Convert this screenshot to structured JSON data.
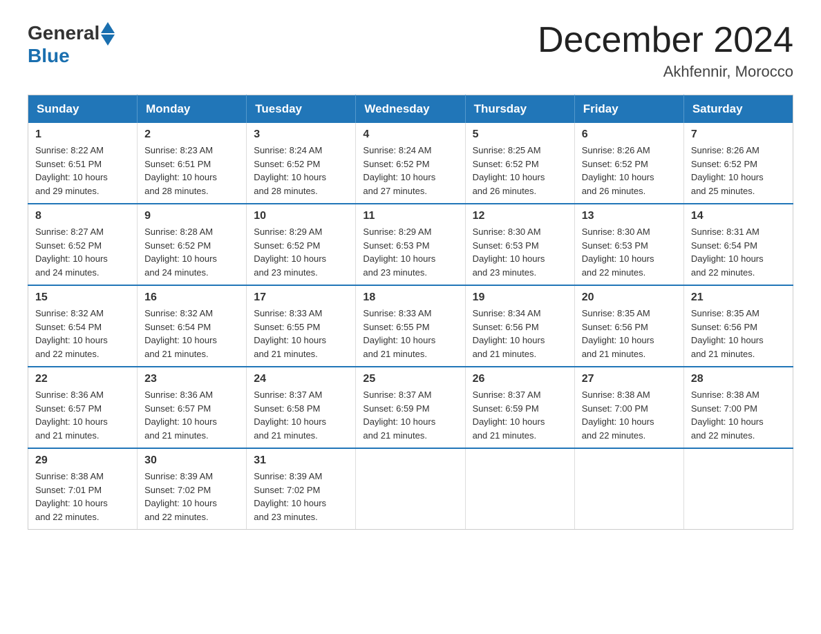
{
  "header": {
    "logo_general": "General",
    "logo_blue": "Blue",
    "month_title": "December 2024",
    "location": "Akhfennir, Morocco"
  },
  "weekdays": [
    "Sunday",
    "Monday",
    "Tuesday",
    "Wednesday",
    "Thursday",
    "Friday",
    "Saturday"
  ],
  "weeks": [
    [
      {
        "day": "1",
        "sunrise": "8:22 AM",
        "sunset": "6:51 PM",
        "daylight": "10 hours and 29 minutes."
      },
      {
        "day": "2",
        "sunrise": "8:23 AM",
        "sunset": "6:51 PM",
        "daylight": "10 hours and 28 minutes."
      },
      {
        "day": "3",
        "sunrise": "8:24 AM",
        "sunset": "6:52 PM",
        "daylight": "10 hours and 28 minutes."
      },
      {
        "day": "4",
        "sunrise": "8:24 AM",
        "sunset": "6:52 PM",
        "daylight": "10 hours and 27 minutes."
      },
      {
        "day": "5",
        "sunrise": "8:25 AM",
        "sunset": "6:52 PM",
        "daylight": "10 hours and 26 minutes."
      },
      {
        "day": "6",
        "sunrise": "8:26 AM",
        "sunset": "6:52 PM",
        "daylight": "10 hours and 26 minutes."
      },
      {
        "day": "7",
        "sunrise": "8:26 AM",
        "sunset": "6:52 PM",
        "daylight": "10 hours and 25 minutes."
      }
    ],
    [
      {
        "day": "8",
        "sunrise": "8:27 AM",
        "sunset": "6:52 PM",
        "daylight": "10 hours and 24 minutes."
      },
      {
        "day": "9",
        "sunrise": "8:28 AM",
        "sunset": "6:52 PM",
        "daylight": "10 hours and 24 minutes."
      },
      {
        "day": "10",
        "sunrise": "8:29 AM",
        "sunset": "6:52 PM",
        "daylight": "10 hours and 23 minutes."
      },
      {
        "day": "11",
        "sunrise": "8:29 AM",
        "sunset": "6:53 PM",
        "daylight": "10 hours and 23 minutes."
      },
      {
        "day": "12",
        "sunrise": "8:30 AM",
        "sunset": "6:53 PM",
        "daylight": "10 hours and 23 minutes."
      },
      {
        "day": "13",
        "sunrise": "8:30 AM",
        "sunset": "6:53 PM",
        "daylight": "10 hours and 22 minutes."
      },
      {
        "day": "14",
        "sunrise": "8:31 AM",
        "sunset": "6:54 PM",
        "daylight": "10 hours and 22 minutes."
      }
    ],
    [
      {
        "day": "15",
        "sunrise": "8:32 AM",
        "sunset": "6:54 PM",
        "daylight": "10 hours and 22 minutes."
      },
      {
        "day": "16",
        "sunrise": "8:32 AM",
        "sunset": "6:54 PM",
        "daylight": "10 hours and 21 minutes."
      },
      {
        "day": "17",
        "sunrise": "8:33 AM",
        "sunset": "6:55 PM",
        "daylight": "10 hours and 21 minutes."
      },
      {
        "day": "18",
        "sunrise": "8:33 AM",
        "sunset": "6:55 PM",
        "daylight": "10 hours and 21 minutes."
      },
      {
        "day": "19",
        "sunrise": "8:34 AM",
        "sunset": "6:56 PM",
        "daylight": "10 hours and 21 minutes."
      },
      {
        "day": "20",
        "sunrise": "8:35 AM",
        "sunset": "6:56 PM",
        "daylight": "10 hours and 21 minutes."
      },
      {
        "day": "21",
        "sunrise": "8:35 AM",
        "sunset": "6:56 PM",
        "daylight": "10 hours and 21 minutes."
      }
    ],
    [
      {
        "day": "22",
        "sunrise": "8:36 AM",
        "sunset": "6:57 PM",
        "daylight": "10 hours and 21 minutes."
      },
      {
        "day": "23",
        "sunrise": "8:36 AM",
        "sunset": "6:57 PM",
        "daylight": "10 hours and 21 minutes."
      },
      {
        "day": "24",
        "sunrise": "8:37 AM",
        "sunset": "6:58 PM",
        "daylight": "10 hours and 21 minutes."
      },
      {
        "day": "25",
        "sunrise": "8:37 AM",
        "sunset": "6:59 PM",
        "daylight": "10 hours and 21 minutes."
      },
      {
        "day": "26",
        "sunrise": "8:37 AM",
        "sunset": "6:59 PM",
        "daylight": "10 hours and 21 minutes."
      },
      {
        "day": "27",
        "sunrise": "8:38 AM",
        "sunset": "7:00 PM",
        "daylight": "10 hours and 22 minutes."
      },
      {
        "day": "28",
        "sunrise": "8:38 AM",
        "sunset": "7:00 PM",
        "daylight": "10 hours and 22 minutes."
      }
    ],
    [
      {
        "day": "29",
        "sunrise": "8:38 AM",
        "sunset": "7:01 PM",
        "daylight": "10 hours and 22 minutes."
      },
      {
        "day": "30",
        "sunrise": "8:39 AM",
        "sunset": "7:02 PM",
        "daylight": "10 hours and 22 minutes."
      },
      {
        "day": "31",
        "sunrise": "8:39 AM",
        "sunset": "7:02 PM",
        "daylight": "10 hours and 23 minutes."
      },
      null,
      null,
      null,
      null
    ]
  ],
  "labels": {
    "sunrise": "Sunrise:",
    "sunset": "Sunset:",
    "daylight": "Daylight:"
  }
}
